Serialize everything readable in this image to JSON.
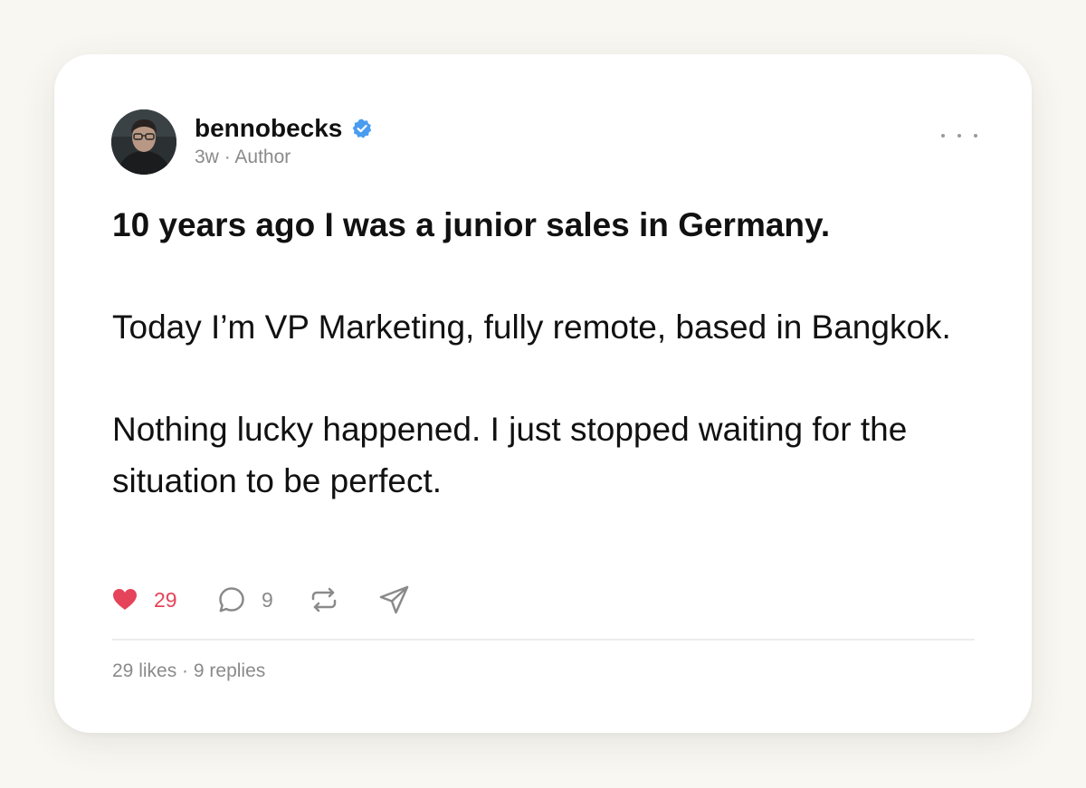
{
  "post": {
    "author": {
      "username": "bennobecks",
      "verified": true,
      "avatar": "avatar-photo",
      "time": "3w",
      "separator": "·",
      "role": "Author"
    },
    "menu_icon": "more-horizontal-icon",
    "content": {
      "headline": "10 years ago I was a junior sales in Germany.",
      "paragraphs": [
        "Today I’m VP Marketing, fully remote, based in Bangkok.",
        "Nothing lucky happened. I just stopped waiting for the situation to be perfect."
      ]
    },
    "actions": {
      "like": {
        "icon": "heart-icon",
        "count": "29",
        "liked": true
      },
      "reply": {
        "icon": "comment-icon",
        "count": "9"
      },
      "repost": {
        "icon": "repost-icon"
      },
      "share": {
        "icon": "send-icon"
      }
    },
    "footer": {
      "likes": "29 likes",
      "separator": "·",
      "replies": "9 replies"
    }
  },
  "colors": {
    "background": "#f8f7f2",
    "card": "#ffffff",
    "text": "#111111",
    "muted": "#8a8a8a",
    "like": "#e5435a",
    "verified": "#4a9cf0"
  }
}
